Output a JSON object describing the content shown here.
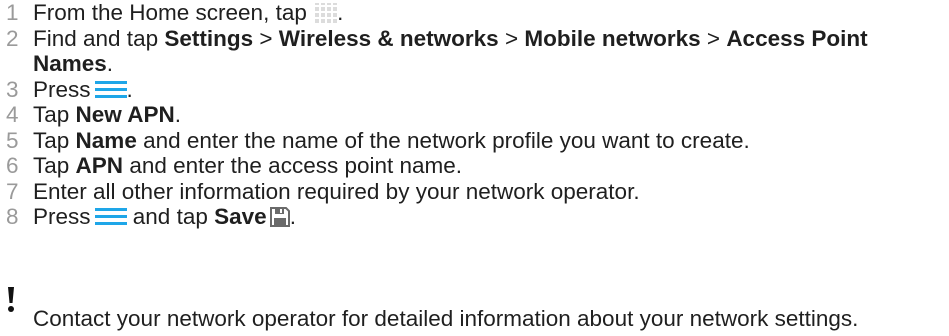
{
  "steps": [
    {
      "num": "1",
      "a": "From the Home screen, tap",
      "b": "."
    },
    {
      "num": "2",
      "a": "Find and tap",
      "b": "Settings",
      "c": ">",
      "d": "Wireless & networks",
      "e": ">",
      "f": "Mobile networks",
      "g": ">",
      "h": "Access Point Names",
      "i": "."
    },
    {
      "num": "3",
      "a": "Press",
      "b": "."
    },
    {
      "num": "4",
      "a": "Tap",
      "b": "New APN",
      "c": "."
    },
    {
      "num": "5",
      "a": "Tap",
      "b": "Name",
      "c": "and enter the name of the network profile you want to create."
    },
    {
      "num": "6",
      "a": "Tap",
      "b": "APN",
      "c": "and enter the access point name."
    },
    {
      "num": "7",
      "a": "Enter all other information required by your network operator."
    },
    {
      "num": "8",
      "a": "Press",
      "b": "and tap",
      "c": "Save",
      "d": "."
    }
  ],
  "note": "Contact your network operator for detailed information about your network settings.",
  "icons": {
    "apps": "apps-grid-icon",
    "menu": "menu-icon",
    "save": "save-icon",
    "note": "exclamation-icon"
  },
  "colors": {
    "step_number": "#9a9a9a",
    "text": "#1f1f1f",
    "menu_icon": "#1ea6e8",
    "apps_icon": "#dcdcdc",
    "save_icon": "#6a6a6a"
  }
}
